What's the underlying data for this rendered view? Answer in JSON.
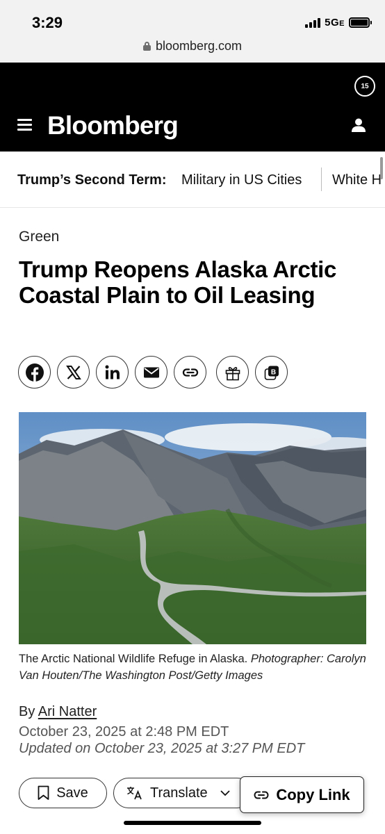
{
  "status_bar": {
    "time": "3:29",
    "network": "5G",
    "network_suffix": "E"
  },
  "browser": {
    "url": "bloomberg.com"
  },
  "header": {
    "logo": "Bloomberg",
    "notification_count": "15"
  },
  "topic_strip": {
    "label": "Trump’s Second Term:",
    "links": [
      "Military in US Cities",
      "White H"
    ]
  },
  "article": {
    "kicker": "Green",
    "headline": "Trump Reopens Alaska Arctic Coastal Plain to Oil Leasing",
    "share_icons": [
      "facebook-icon",
      "x-icon",
      "linkedin-icon",
      "email-icon",
      "link-icon",
      "gift-icon",
      "bloomberg-terminal-icon"
    ],
    "caption_text": "The Arctic National Wildlife Refuge in Alaska.",
    "caption_credit": "Photographer: Carolyn Van Houten/The Washington Post/Getty Images",
    "byline_prefix": "By",
    "author": "Ari Natter",
    "published": "October 23, 2025 at 2:48 PM EDT",
    "updated": "Updated on October 23, 2025 at 3:27 PM EDT"
  },
  "actions": {
    "save_label": "Save",
    "translate_label": "Translate",
    "copy_link_label": "Copy Link"
  },
  "colors": {
    "header_bg": "#000000",
    "status_bg": "#f2f2f2",
    "text": "#111111",
    "muted": "#555555"
  }
}
